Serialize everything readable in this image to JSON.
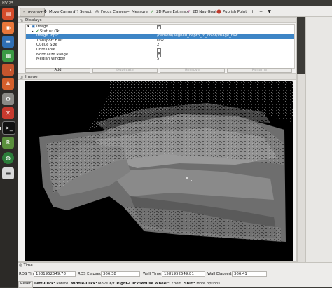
{
  "window": {
    "title": "RViz*"
  },
  "toolbar": {
    "items": [
      {
        "label": "Interact",
        "icon": "interact-icon",
        "active": true
      },
      {
        "label": "Move Camera",
        "icon": "move-camera-icon"
      },
      {
        "label": "Select",
        "icon": "select-icon"
      },
      {
        "label": "Focus Camera",
        "icon": "focus-camera-icon"
      },
      {
        "label": "Measure",
        "icon": "measure-icon"
      },
      {
        "label": "2D Pose Estimate",
        "icon": "pose-estimate-icon"
      },
      {
        "label": "2D Nav Goal",
        "icon": "nav-goal-icon"
      },
      {
        "label": "Publish Point",
        "icon": "publish-point-icon"
      }
    ],
    "extra": [
      "+",
      "−",
      "▼"
    ]
  },
  "displays": {
    "title": "Displays",
    "rows": [
      {
        "key": "Image",
        "checked": true
      },
      {
        "key": "Status: Ok",
        "checked": true
      },
      {
        "key": "Image Topic",
        "value": "/camera/aligned_depth_to_color/image_raw",
        "selected": true
      },
      {
        "key": "Transport Hint",
        "value": "raw"
      },
      {
        "key": "Queue Size",
        "value": "2"
      },
      {
        "key": "Unreliable",
        "checked": false
      },
      {
        "key": "Normalize Range",
        "checked": true
      },
      {
        "key": "Median window",
        "value": "5"
      }
    ],
    "buttons": {
      "add": "Add",
      "duplicate": "Duplicate",
      "remove": "Remove",
      "rename": "Rename"
    }
  },
  "image_panel": {
    "title": "Image"
  },
  "time_panel": {
    "title": "Time",
    "ros_time_label": "ROS Time:",
    "ros_time": "1581952549.78",
    "ros_elapsed_label": "ROS Elapsed:",
    "ros_elapsed": "366.38",
    "wall_time_label": "Wall Time:",
    "wall_time": "1581952549.81",
    "wall_elapsed_label": "Wall Elapsed:",
    "wall_elapsed": "366.41",
    "reset": "Reset",
    "hint_prefix1": "Left-Click:",
    "hint_text1": " Rotate. ",
    "hint_prefix2": "Middle-Click:",
    "hint_text2": " Move X/Y. ",
    "hint_prefix3": "Right-Click/Mouse Wheel:",
    "hint_text3": ": Zoom. ",
    "hint_prefix4": "Shift:",
    "hint_text4": " More options."
  },
  "launcher_icons": [
    "files-icon",
    "firefox-icon",
    "writer-icon",
    "calc-icon",
    "impress-icon",
    "software-center-icon",
    "settings-icon",
    "terminal-icon",
    "rviz-icon",
    "globe-icon",
    "drive-icon"
  ],
  "colors": {
    "selection": "#3d85c6",
    "launcher_bg": "#2c2a27",
    "panel_bg": "#f2f1f0"
  }
}
